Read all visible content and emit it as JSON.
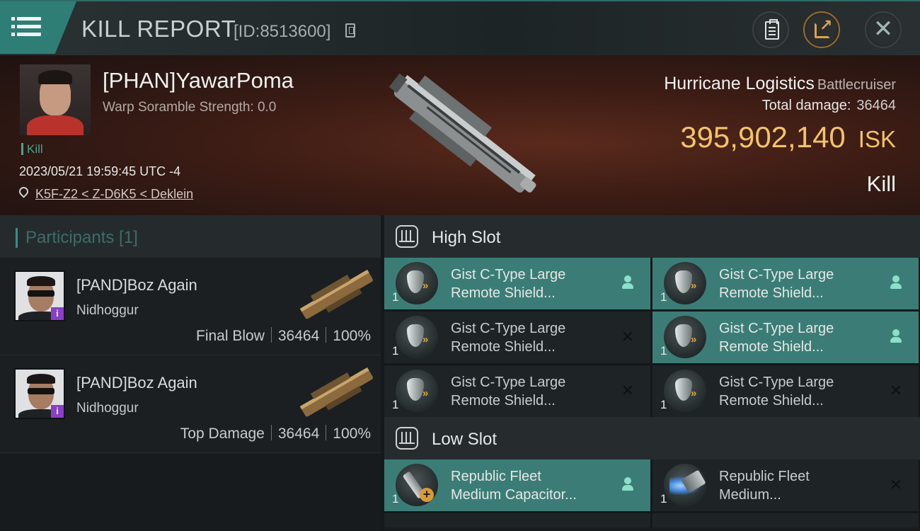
{
  "header": {
    "title": "KILL REPORT",
    "kill_id": "[ID:8513600]"
  },
  "victim": {
    "name": "[PHAN]YawarPoma",
    "warp_scramble": "Warp Soramble Strength: 0.0",
    "kill_tag": "Kill",
    "timestamp": "2023/05/21 19:59:45 UTC -4",
    "location": "K5F-Z2 < Z-D6K5 < Deklein",
    "ship_name": "Hurricane Logistics",
    "ship_class": "Battlecruiser",
    "total_damage_label": "Total damage:",
    "total_damage": "36464",
    "isk_value": "395,902,140",
    "isk_unit": "ISK",
    "result": "Kill"
  },
  "participants": {
    "title": "Participants [1]",
    "rows": [
      {
        "name": "[PAND]Boz Again",
        "ship": "Nidhoggur",
        "role": "Final Blow",
        "damage": "36464",
        "percent": "100%"
      },
      {
        "name": "[PAND]Boz Again",
        "ship": "Nidhoggur",
        "role": "Top Damage",
        "damage": "36464",
        "percent": "100%"
      }
    ]
  },
  "high_slot": {
    "title": "High Slot",
    "modules": [
      {
        "qty": "1",
        "line1": "Gist C-Type Large",
        "line2": "Remote Shield...",
        "status": "fitted"
      },
      {
        "qty": "1",
        "line1": "Gist C-Type Large",
        "line2": "Remote Shield...",
        "status": "fitted"
      },
      {
        "qty": "1",
        "line1": "Gist C-Type Large",
        "line2": "Remote Shield...",
        "status": "destroyed"
      },
      {
        "qty": "1",
        "line1": "Gist C-Type Large",
        "line2": "Remote Shield...",
        "status": "fitted"
      },
      {
        "qty": "1",
        "line1": "Gist C-Type Large",
        "line2": "Remote Shield...",
        "status": "destroyed"
      },
      {
        "qty": "1",
        "line1": "Gist C-Type Large",
        "line2": "Remote Shield...",
        "status": "destroyed"
      }
    ]
  },
  "low_slot": {
    "title": "Low Slot",
    "modules": [
      {
        "qty": "1",
        "line1": "Republic Fleet",
        "line2": "Medium Capacitor...",
        "status": "fitted"
      },
      {
        "qty": "1",
        "line1": "Republic Fleet",
        "line2": "Medium...",
        "status": "destroyed"
      }
    ]
  },
  "icons": {
    "menu": "hamburger-menu-icon",
    "copy": "copy-icon",
    "clipboard": "clipboard-icon",
    "share": "share-icon",
    "close": "close-icon",
    "location": "location-pin-icon",
    "dropped": "person-icon",
    "destroyed": "x-icon"
  },
  "colors": {
    "accent_teal": "#3b7d76",
    "isk_gold": "#f2c36b",
    "kill_green": "#4aa38f",
    "share_orange": "#e2a04b",
    "badge_purple": "#8a3fc7"
  }
}
